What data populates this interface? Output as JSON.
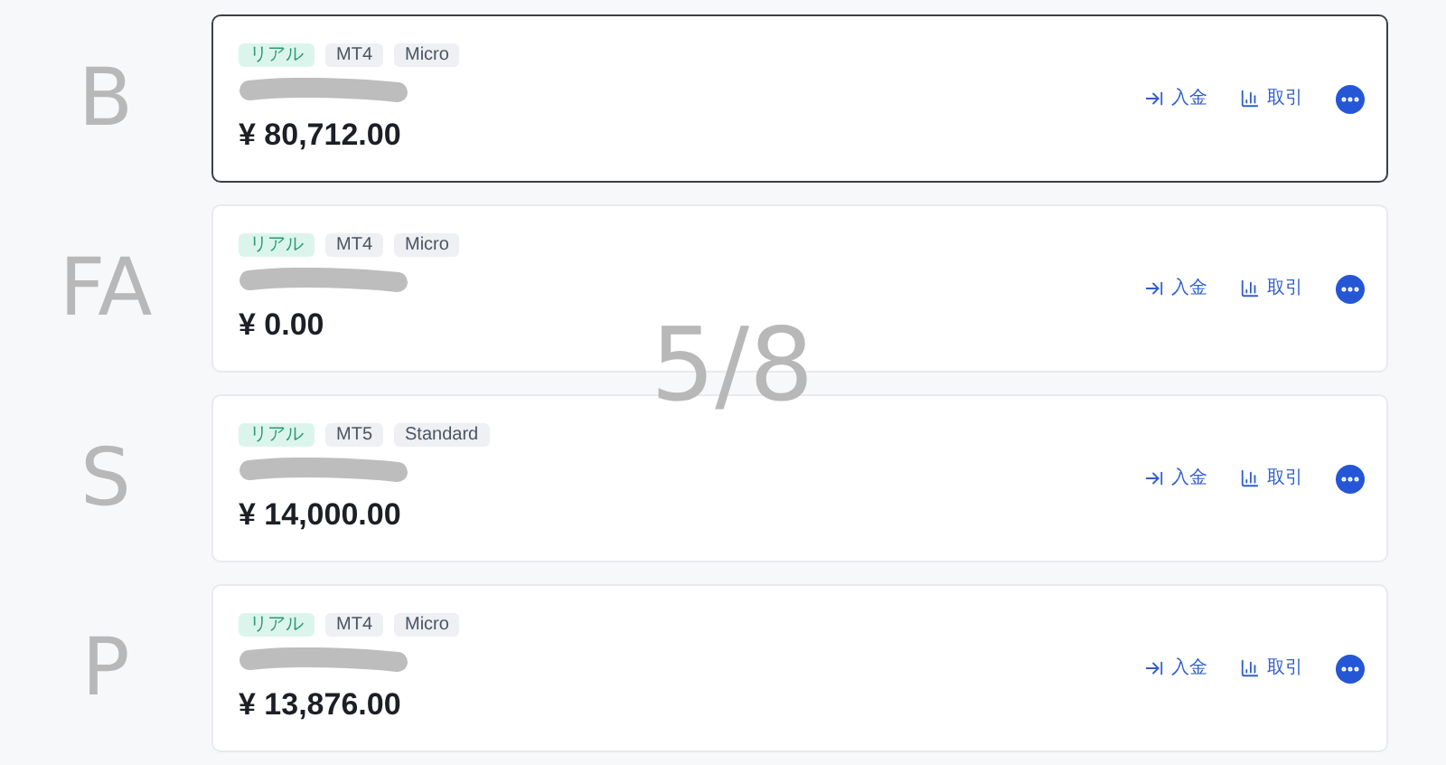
{
  "accounts": [
    {
      "selected": true,
      "annotation": "B",
      "tags": [
        {
          "label": "リアル",
          "kind": "status"
        },
        {
          "label": "MT4",
          "kind": "plain"
        },
        {
          "label": "Micro",
          "kind": "plain"
        }
      ],
      "balance": "¥ 80,712.00",
      "actions": [
        "入金",
        "取引"
      ]
    },
    {
      "selected": false,
      "annotation": "FA",
      "tags": [
        {
          "label": "リアル",
          "kind": "status"
        },
        {
          "label": "MT4",
          "kind": "plain"
        },
        {
          "label": "Micro",
          "kind": "plain"
        }
      ],
      "balance": "¥ 0.00",
      "actions": [
        "入金",
        "取引"
      ]
    },
    {
      "selected": false,
      "annotation": "S",
      "tags": [
        {
          "label": "リアル",
          "kind": "status"
        },
        {
          "label": "MT5",
          "kind": "plain"
        },
        {
          "label": "Standard",
          "kind": "plain"
        }
      ],
      "balance": "¥ 14,000.00",
      "actions": [
        "入金",
        "取引"
      ]
    },
    {
      "selected": false,
      "annotation": "P",
      "tags": [
        {
          "label": "リアル",
          "kind": "status"
        },
        {
          "label": "MT4",
          "kind": "plain"
        },
        {
          "label": "Micro",
          "kind": "plain"
        }
      ],
      "balance": "¥ 13,876.00",
      "actions": [
        "入金",
        "取引"
      ]
    }
  ],
  "page_annotation": "5/8"
}
